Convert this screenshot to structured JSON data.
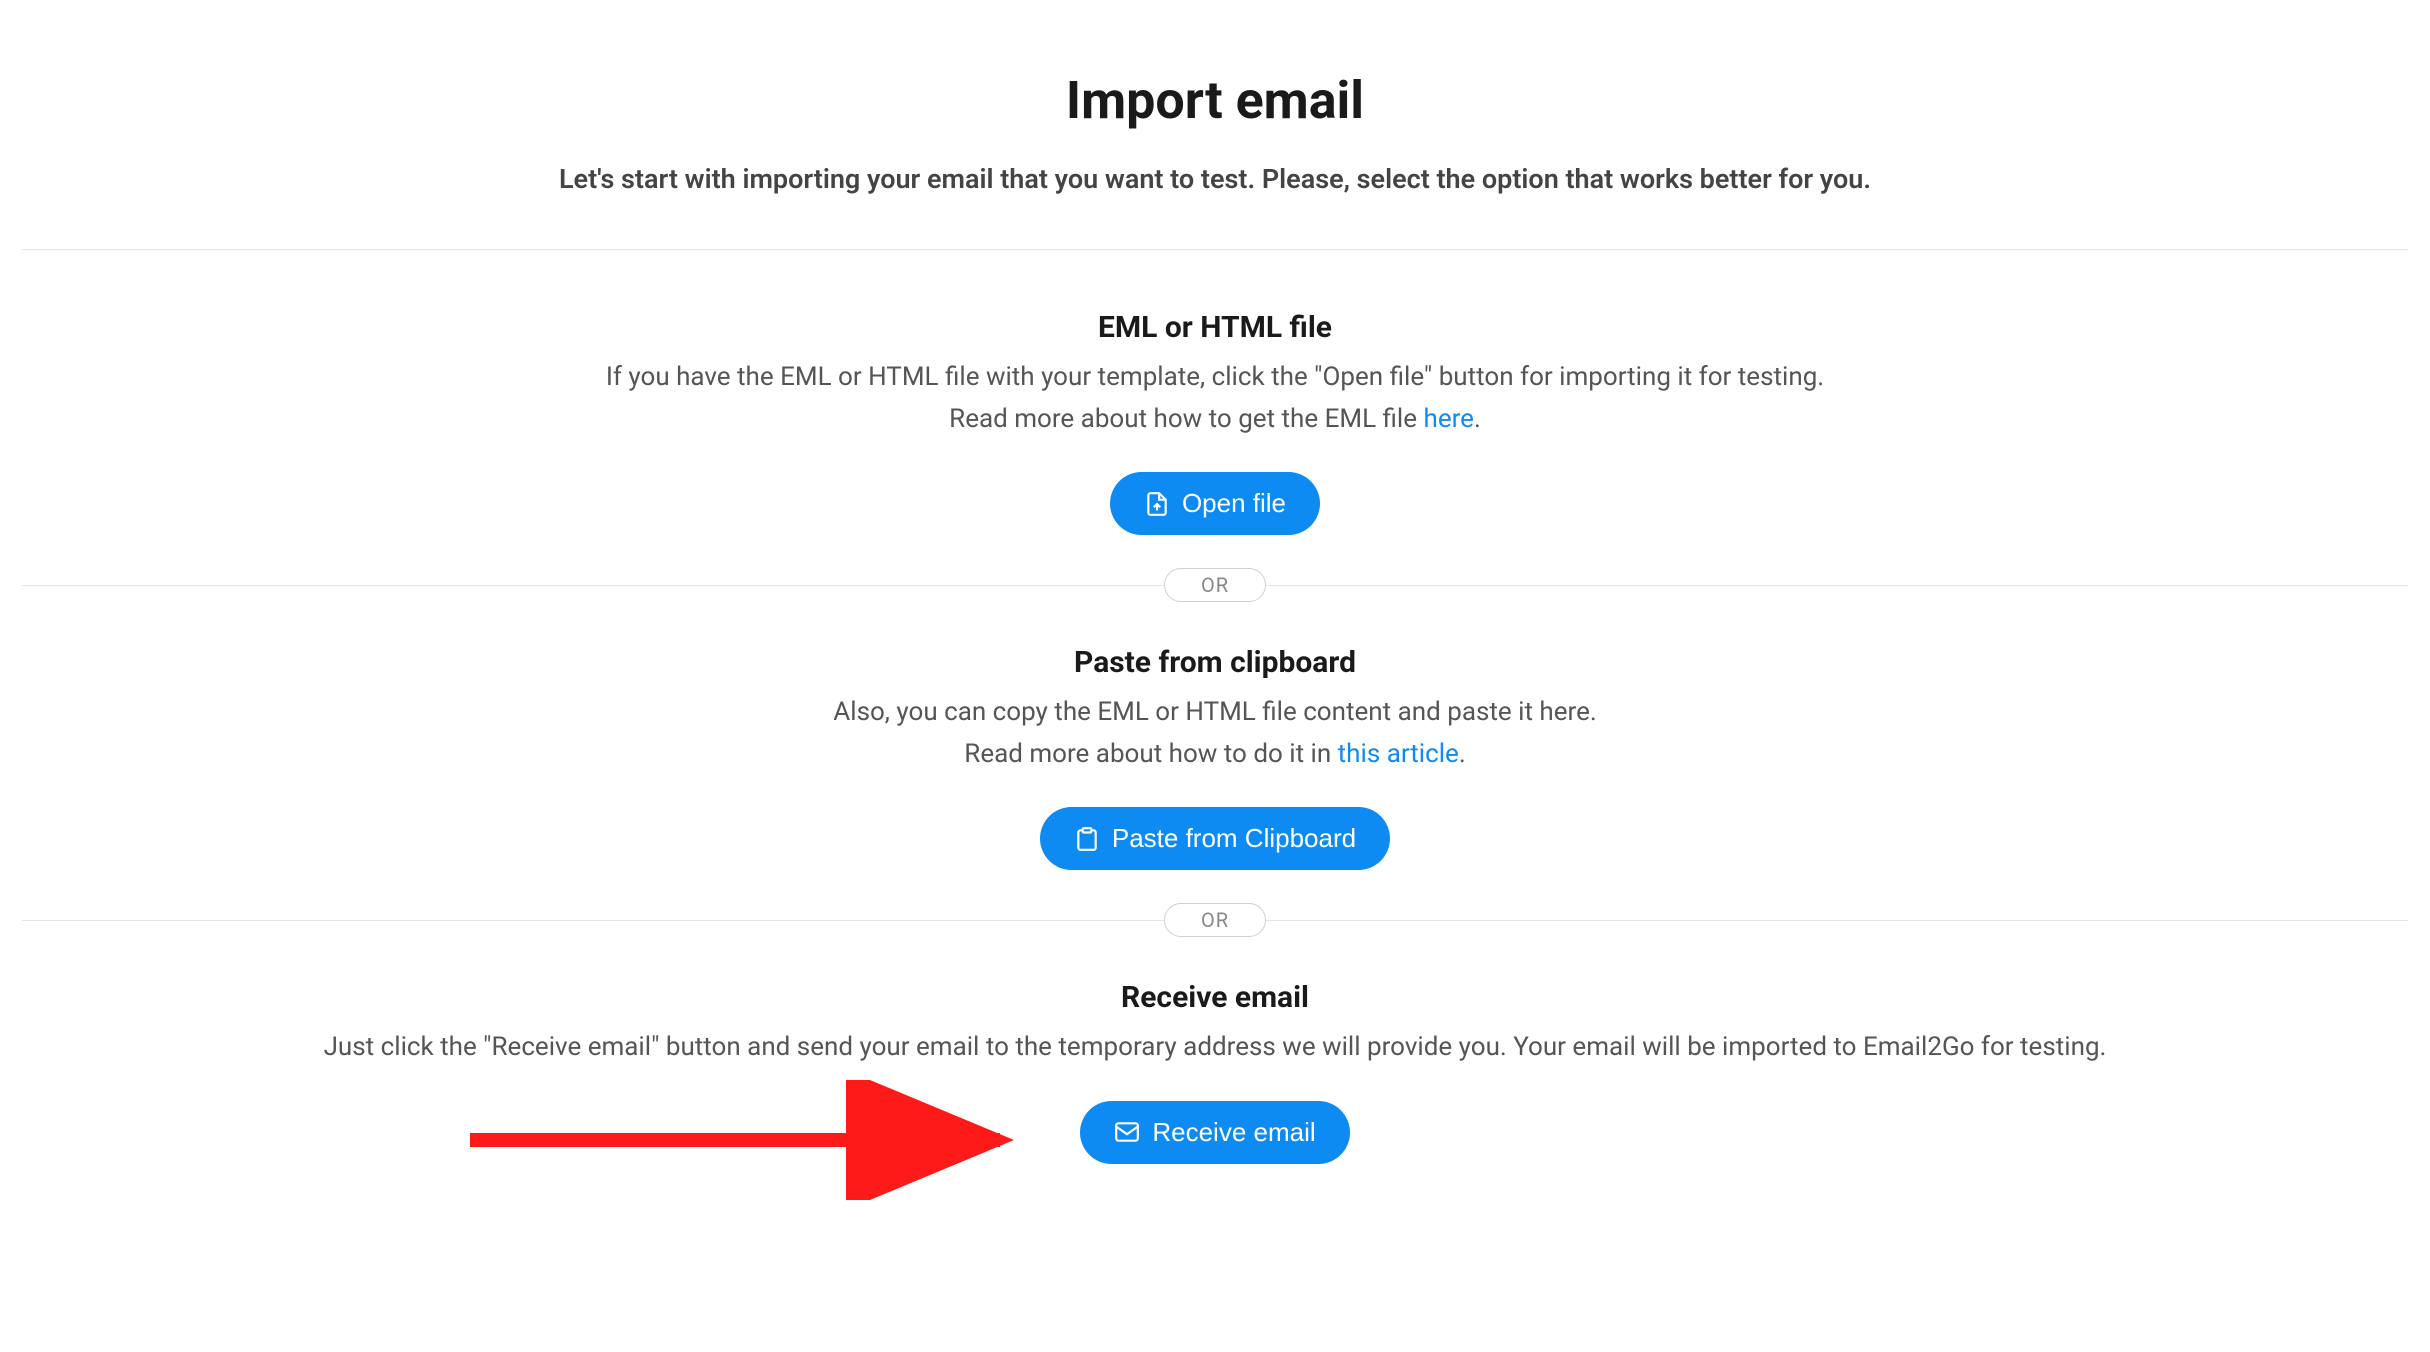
{
  "page": {
    "title": "Import email",
    "subtitle": "Let's start with importing your email that you want to test. Please, select the option that works better for you."
  },
  "section1": {
    "title": "EML or HTML file",
    "desc_line1": "If you have the EML or HTML file with your template, click the \"Open file\" button for importing it for testing.",
    "desc_line2_prefix": "Read more about how to get the EML file ",
    "desc_line2_link": "here",
    "desc_line2_suffix": ".",
    "button": "Open file"
  },
  "divider_label": "OR",
  "section2": {
    "title": "Paste from clipboard",
    "desc_line1": "Also, you can copy the EML or HTML file content and paste it here.",
    "desc_line2_prefix": "Read more about how to do it in ",
    "desc_line2_link": "this article",
    "desc_line2_suffix": ".",
    "button": "Paste from Clipboard"
  },
  "section3": {
    "title": "Receive email",
    "desc": "Just click the \"Receive email\" button and send your email to the temporary address we will provide you. Your email will be imported to Email2Go for testing.",
    "button": "Receive email"
  }
}
